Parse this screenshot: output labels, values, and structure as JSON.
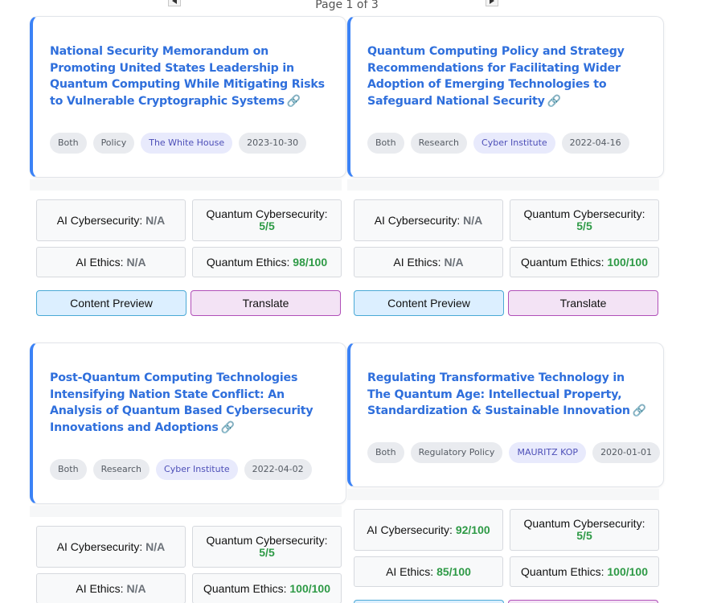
{
  "pagination": {
    "label": "Page 1 of 3"
  },
  "cards": [
    {
      "title": "National Security Memorandum on Promoting United States Leadership in Quantum Computing While Mitigating Risks to Vulnerable Cryptographic Systems",
      "tags": [
        "Both",
        "Policy",
        "The White House",
        "2023-10-30"
      ],
      "metrics": {
        "ai_cyber_label": "AI Cybersecurity:",
        "ai_cyber_value": "N/A",
        "q_cyber_label": "Quantum Cybersecurity:",
        "q_cyber_value": "5/5",
        "ai_ethics_label": "AI Ethics:",
        "ai_ethics_value": "N/A",
        "q_ethics_label": "Quantum Ethics:",
        "q_ethics_value": "98/100"
      },
      "buttons": {
        "preview": "Content Preview",
        "translate": "Translate"
      }
    },
    {
      "title": "Quantum Computing Policy and Strategy Recommendations for Facilitating Wider Adoption of Emerging Technologies to Safeguard National Security",
      "tags": [
        "Both",
        "Research",
        "Cyber Institute",
        "2022-04-16"
      ],
      "metrics": {
        "ai_cyber_label": "AI Cybersecurity:",
        "ai_cyber_value": "N/A",
        "q_cyber_label": "Quantum Cybersecurity:",
        "q_cyber_value": "5/5",
        "ai_ethics_label": "AI Ethics:",
        "ai_ethics_value": "N/A",
        "q_ethics_label": "Quantum Ethics:",
        "q_ethics_value": "100/100"
      },
      "buttons": {
        "preview": "Content Preview",
        "translate": "Translate"
      }
    },
    {
      "title": "Post-Quantum Computing Technologies Intensifying Nation State Conflict: An Analysis of Quantum Based Cybersecurity Innovations and Adoptions",
      "tags": [
        "Both",
        "Research",
        "Cyber Institute",
        "2022-04-02"
      ],
      "metrics": {
        "ai_cyber_label": "AI Cybersecurity:",
        "ai_cyber_value": "N/A",
        "q_cyber_label": "Quantum Cybersecurity:",
        "q_cyber_value": "5/5",
        "ai_ethics_label": "AI Ethics:",
        "ai_ethics_value": "N/A",
        "q_ethics_label": "Quantum Ethics:",
        "q_ethics_value": "100/100"
      }
    },
    {
      "title": "Regulating Transformative Technology in The Quantum Age: Intellectual Property, Standardization & Sustainable Innovation",
      "tags": [
        "Both",
        "Regulatory Policy",
        "MAURITZ KOP",
        "2020-01-01"
      ],
      "metrics": {
        "ai_cyber_label": "AI Cybersecurity:",
        "ai_cyber_value": "92/100",
        "q_cyber_label": "Quantum Cybersecurity:",
        "q_cyber_value": "5/5",
        "ai_ethics_label": "AI Ethics:",
        "ai_ethics_value": "85/100",
        "q_ethics_label": "Quantum Ethics:",
        "q_ethics_value": "100/100"
      }
    }
  ],
  "colors": {
    "accent": "#3b82f6",
    "title": "#2f6fdc",
    "good_score": "#2e9a46",
    "na_score": "#6b7178"
  },
  "icons": {
    "link": "link-icon"
  }
}
